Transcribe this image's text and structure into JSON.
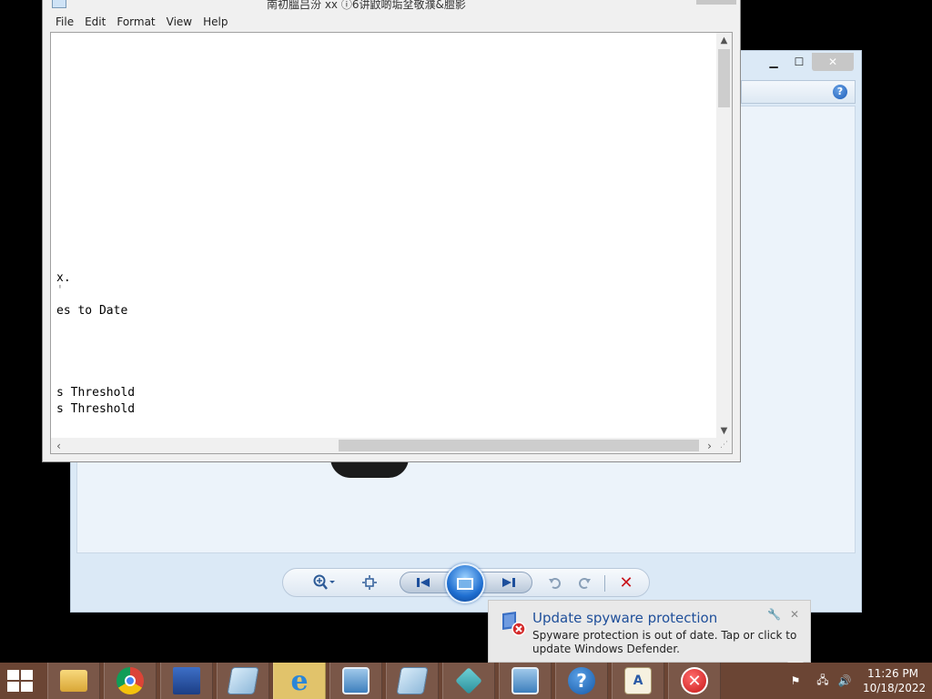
{
  "notepad": {
    "title": "南初膃吕汾 xx ⓘ6讲鼤啲垢坌敬濮&膻影",
    "menu": [
      "File",
      "Edit",
      "Format",
      "View",
      "Help"
    ],
    "lines": {
      "l1": "x.",
      "l2": "'",
      "l3": "es to Date",
      "l4": "s Threshold",
      "l5": "s Threshold"
    }
  },
  "viewer": {
    "help_label": "?"
  },
  "toast": {
    "title": "Update spyware protection",
    "body": "Spyware protection is out of date. Tap or click to update Windows Defender."
  },
  "taskbar": {
    "apps": [
      {
        "name": "file-explorer",
        "icon": "folder-icon"
      },
      {
        "name": "google-chrome",
        "icon": "chrome-icon"
      },
      {
        "name": "installer",
        "icon": "installer-icon"
      },
      {
        "name": "notepad",
        "icon": "notepad-icon"
      },
      {
        "name": "internet-explorer",
        "icon": "ie-icon"
      },
      {
        "name": "photo-viewer",
        "icon": "photo-icon"
      },
      {
        "name": "notepad-2",
        "icon": "notepad-icon"
      },
      {
        "name": "app-cubes",
        "icon": "cubes-icon"
      },
      {
        "name": "photo-viewer-2",
        "icon": "photo-icon"
      },
      {
        "name": "help-support",
        "icon": "help-icon"
      },
      {
        "name": "wordpad",
        "icon": "document-icon"
      },
      {
        "name": "error-app",
        "icon": "error-icon"
      }
    ],
    "ie_glyph": "e",
    "help_glyph": "?",
    "error_glyph": "✕",
    "doc_glyph": "A",
    "time": "11:26 PM",
    "date": "10/18/2022"
  },
  "colors": {
    "taskbar": "#6b4534",
    "active_taskbar_button": "#e1c36b",
    "toast_title": "#1f4f9a",
    "delete_red": "#c8141b"
  }
}
